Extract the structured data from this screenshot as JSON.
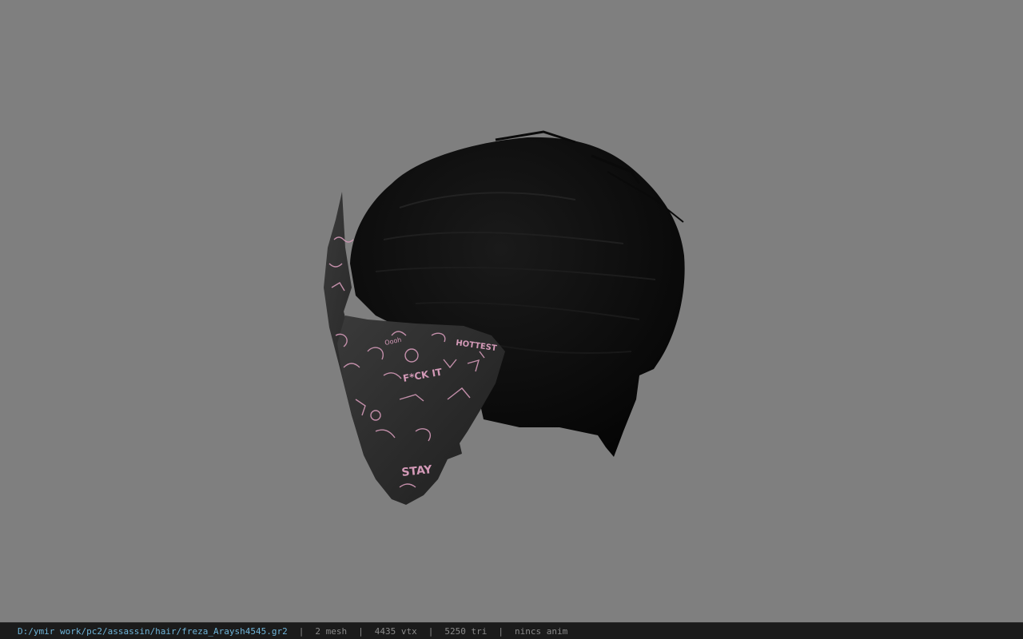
{
  "status_bar": {
    "file_path": "D:/ymir work/pc2/assassin/hair/freza_Araysh4545.gr2",
    "separator": "|",
    "mesh_count": "2 mesh",
    "vertex_count": "4435 vtx",
    "triangle_count": "5250 tri",
    "anim_status": "nincs anim"
  },
  "colors": {
    "viewport_background": "#7f7f7f",
    "hair": "#0c0c0c",
    "mask": "#2a2a2a",
    "mask_pattern": "#d49ab8",
    "path_text": "#6fb4d8",
    "status_text": "#8a8a8a"
  },
  "mask_decal_texts": [
    "HOTTEST",
    "STAY",
    "F*CK IT",
    "Oooh"
  ]
}
